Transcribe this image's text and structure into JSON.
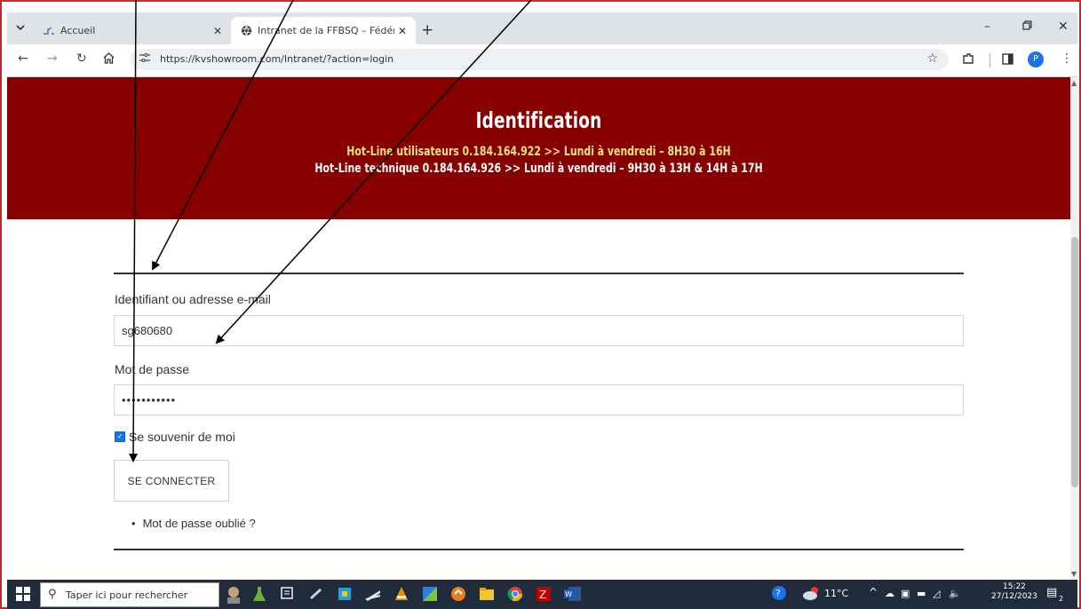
{
  "browser": {
    "tabs": [
      {
        "title": "Accueil",
        "favicon": "accueil-icon",
        "active": false
      },
      {
        "title": "Intranet de la FFBSQ – Fédérati",
        "favicon": "globe-icon",
        "active": true
      }
    ],
    "url": "https://kvshowroom.com/Intranet/?action=login",
    "profile_initial": "P"
  },
  "page": {
    "title": "Identification",
    "hotline_users": "Hot-Line utilisateurs 0.184.164.922 >> Lundi à vendredi – 8H30 à 16H",
    "hotline_tech": "Hot-Line technique 0.184.164.926 >> Lundi à vendredi – 9H30 à 13H & 14H à 17H",
    "hero_color": "#870000",
    "form": {
      "username_label": "Identifiant ou adresse e-mail",
      "username_value": "sg680680",
      "password_label": "Mot de passe",
      "password_value": "•••••••••••",
      "remember_label": "Se souvenir de moi",
      "remember_checked": true,
      "submit_label": "SE CONNECTER",
      "forgot_link": "Mot de passe oublié ?"
    }
  },
  "taskbar": {
    "search_placeholder": "Taper ici pour rechercher",
    "weather": "11°C",
    "time": "15:22",
    "date": "27/12/2023",
    "notification_count": "2"
  }
}
